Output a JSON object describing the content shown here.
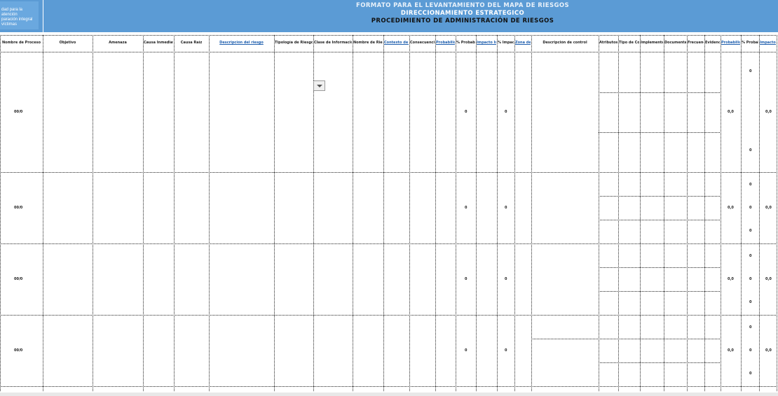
{
  "logo": {
    "text": "dad para la atención\nparación integral\nvíctimas"
  },
  "header": {
    "title_1": "FORMATO PARA EL LEVANTAMIENTO DEL MAPA DE RIESGOS",
    "title_2": "DIRECCIONAMIENTO ESTRATEGICO",
    "title_3": "PROCEDIMIENTO DE ADMINISTRACIÓN DE RIESGOS"
  },
  "columns": [
    {
      "label": "Nombre de Proceso",
      "link": false
    },
    {
      "label": "Objetivo",
      "link": false
    },
    {
      "label": "Amenaza",
      "link": false
    },
    {
      "label": "Causa Inmediata",
      "link": false
    },
    {
      "label": "Causa Raíz",
      "link": false
    },
    {
      "label": "Descripción del riesgo",
      "link": true
    },
    {
      "label": "Tipología de Riesgo",
      "link": false
    },
    {
      "label": "Clase de Información",
      "link": false
    },
    {
      "label": "Nombre de Riesgo",
      "link": false
    },
    {
      "label": "Contexto de Riesgo",
      "link": true
    },
    {
      "label": "Consecuencias de la Entidad",
      "link": false
    },
    {
      "label": "Probabilidad Inherente",
      "link": true
    },
    {
      "label": "% Probabilidad",
      "link": false
    },
    {
      "label": "Impacto Inherente",
      "link": true
    },
    {
      "label": "% Impacto",
      "link": false
    },
    {
      "label": "Zona de Riesgo Inherente",
      "link": true
    },
    {
      "label": "Descripción de control",
      "link": false
    },
    {
      "label": "Atributos de los controles",
      "link": false
    },
    {
      "label": "Tipo de Control",
      "link": false
    },
    {
      "label": "Implementación",
      "link": false
    },
    {
      "label": "Documentación",
      "link": false
    },
    {
      "label": "Frecuencia",
      "link": false
    },
    {
      "label": "Evidencia",
      "link": false
    },
    {
      "label": "Probabilidad Residual",
      "link": true
    },
    {
      "label": "% Probabilidad",
      "link": false
    },
    {
      "label": "Impacto Residual",
      "link": true
    }
  ],
  "rows": [
    {
      "process": "00/0",
      "prob": "0",
      "impact": "0",
      "residual_prob": "0,0",
      "residual_impact": "0,0",
      "prob_pct": [
        "0",
        "0"
      ]
    },
    {
      "process": "00/0",
      "prob": "0",
      "impact": "0",
      "residual_prob": "0,0",
      "residual_impact": "0,0",
      "prob_pct": [
        "0",
        "0",
        "0"
      ]
    },
    {
      "process": "00/0",
      "prob": "0",
      "impact": "0",
      "residual_prob": "0,0",
      "residual_impact": "0,0",
      "prob_pct": [
        "0",
        "0",
        "0"
      ]
    },
    {
      "process": "00/0",
      "prob": "0",
      "impact": "0",
      "residual_prob": "0,0",
      "residual_impact": "0,0",
      "prob_pct": [
        "0",
        "0",
        "0"
      ]
    }
  ]
}
